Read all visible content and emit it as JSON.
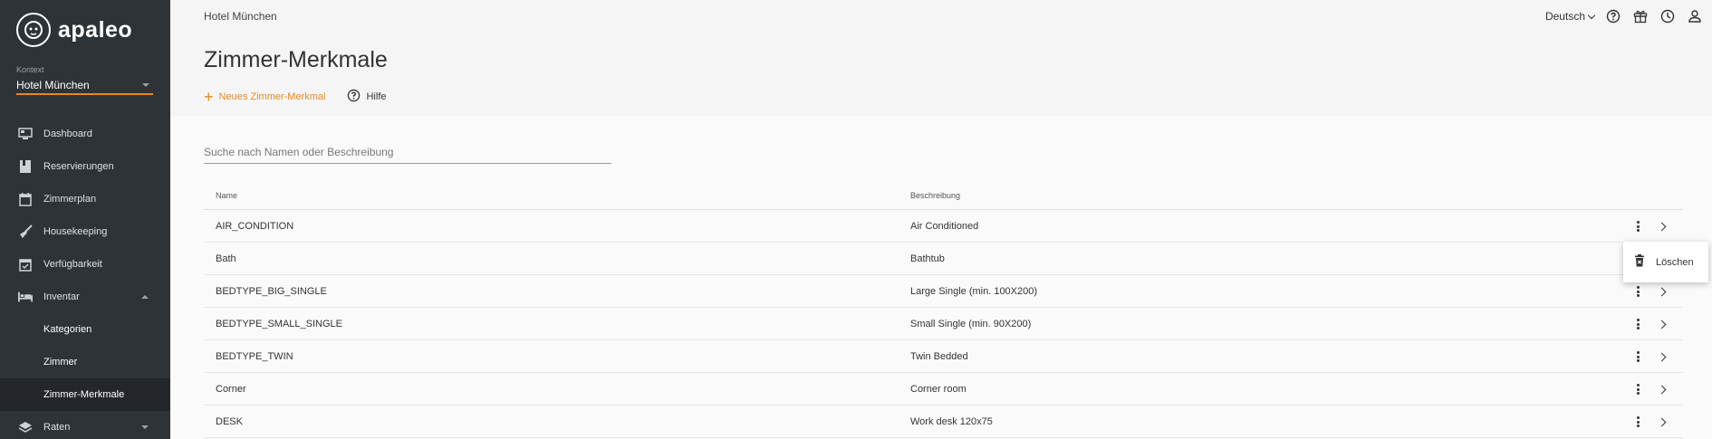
{
  "brand": {
    "name": "apaleo"
  },
  "context": {
    "label": "Kontext",
    "value": "Hotel München"
  },
  "sidebar": {
    "items": [
      {
        "label": "Dashboard",
        "icon": "dashboard-icon"
      },
      {
        "label": "Reservierungen",
        "icon": "book-icon"
      },
      {
        "label": "Zimmerplan",
        "icon": "calendar-icon"
      },
      {
        "label": "Housekeeping",
        "icon": "broom-icon"
      },
      {
        "label": "Verfügbarkeit",
        "icon": "calendar-check-icon"
      },
      {
        "label": "Inventar",
        "icon": "bed-icon",
        "expanded": true
      },
      {
        "label": "Raten",
        "icon": "layers-icon",
        "expanded": false
      }
    ],
    "inventar_sub": [
      {
        "label": "Kategorien"
      },
      {
        "label": "Zimmer"
      },
      {
        "label": "Zimmer-Merkmale",
        "active": true
      }
    ]
  },
  "topbar": {
    "breadcrumb": "Hotel München",
    "language": "Deutsch",
    "icons": [
      "help-icon",
      "gift-icon",
      "clock-icon",
      "user-icon"
    ]
  },
  "page": {
    "title": "Zimmer-Merkmale",
    "new_label": "Neues Zimmer-Merkmal",
    "help_label": "Hilfe"
  },
  "search": {
    "placeholder": "Suche nach Namen oder Beschreibung",
    "value": ""
  },
  "table": {
    "columns": [
      "Name",
      "Beschreibung"
    ],
    "rows": [
      {
        "name": "AIR_CONDITION",
        "description": "Air Conditioned"
      },
      {
        "name": "Bath",
        "description": "Bathtub"
      },
      {
        "name": "BEDTYPE_BIG_SINGLE",
        "description": "Large Single (min. 100X200)"
      },
      {
        "name": "BEDTYPE_SMALL_SINGLE",
        "description": "Small Single (min. 90X200)"
      },
      {
        "name": "BEDTYPE_TWIN",
        "description": "Twin Bedded"
      },
      {
        "name": "Corner",
        "description": "Corner room"
      },
      {
        "name": "DESK",
        "description": "Work desk 120x75"
      }
    ]
  },
  "context_menu": {
    "delete_label": "Löschen"
  },
  "colors": {
    "accent": "#e8891c",
    "sidebar_bg": "#2e3338",
    "sidebar_active": "#23272b"
  }
}
